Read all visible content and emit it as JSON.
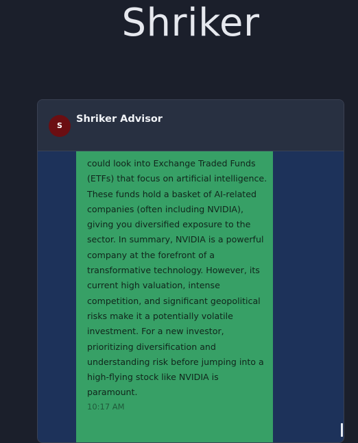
{
  "app": {
    "title": "Shriker"
  },
  "chat": {
    "header": {
      "avatar_initial": "S",
      "advisor_name": "Shriker Advisor"
    },
    "message": {
      "text": "could look into Exchange Traded Funds\n(ETFs) that focus on artificial intelligence.\nThese funds hold a basket of AI-related\ncompanies (often including NVIDIA),\ngiving you diversified exposure to the\nsector. In summary, NVIDIA is a powerful\ncompany at the forefront of a\ntransformative technology. However, its\ncurrent high valuation, intense\ncompetition, and significant geopolitical\nrisks make it a potentially volatile\ninvestment. For a new investor,\nprioritizing diversification and\nunderstanding risk before jumping into a\nhigh-flying stock like NVIDIA is\nparamount.",
      "timestamp": "10:17 AM"
    }
  },
  "colors": {
    "page_background": "#1b1f2b",
    "header_background": "#283041",
    "messages_background": "#1d325a",
    "bubble_background": "#37a066",
    "avatar_background": "#6b0e12"
  }
}
